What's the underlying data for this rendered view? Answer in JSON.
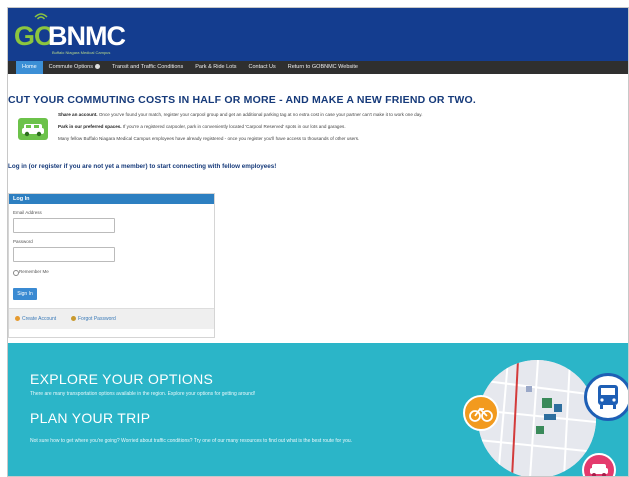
{
  "brand": {
    "logo_go": "GO",
    "logo_name": "BNMC",
    "tagline": "Buffalo Niagara Medical Campus"
  },
  "nav": {
    "items": [
      {
        "label": "Home",
        "active": true
      },
      {
        "label": "Commute Options",
        "has_dropdown": true
      },
      {
        "label": "Transit and Traffic Conditions"
      },
      {
        "label": "Park & Ride Lots"
      },
      {
        "label": "Contact Us"
      },
      {
        "label": "Return to GOBNMC Website"
      }
    ]
  },
  "main": {
    "headline": "CUT YOUR COMMUTING COSTS IN HALF OR MORE - AND MAKE A NEW FRIEND OR TWO.",
    "benefits": [
      {
        "bold": "Share an account.",
        "text": " Once you've found your match, register your carpool group and get an additional parking tag at no extra cost in case your partner can't make it to work one day."
      },
      {
        "bold": "Park in our preferred spaces.",
        "text": " If you're a registered carpooler, park in conveniently located 'Carpool Reserved' spots in our lots and garages."
      },
      {
        "bold": "",
        "text": "Many fellow Buffalo Niagara Medical Campus employees have already registered - once you register you'll have access to thousands of other users."
      }
    ],
    "login_prompt": "Log in (or register if you are not yet a member) to start connecting with fellow employees!"
  },
  "login": {
    "title": "Log In",
    "email_label": "Email Address",
    "email_value": "",
    "password_label": "Password",
    "password_value": "",
    "remember_label": "Remember Me",
    "signin_label": "Sign In",
    "create_account": "Create Account",
    "forgot_password": "Forgot Password"
  },
  "band": {
    "explore_title": "EXPLORE YOUR OPTIONS",
    "explore_text": "There are many transportation options available in the region. Explore your options for getting around!",
    "plan_title": "PLAN YOUR TRIP",
    "plan_text": "Not sure how to get where you're going? Worried about traffic conditions? Try one of our many resources to find out what is the best route for you."
  },
  "colors": {
    "header": "#143d8f",
    "nav": "#2f2f2f",
    "nav_active": "#3c8fd6",
    "accent_green": "#6cc24a",
    "band": "#2bb5c8"
  },
  "icons": [
    "wifi-icon",
    "car-icon",
    "user-icon",
    "key-icon",
    "bike-icon",
    "bus-icon",
    "car-pink-icon",
    "map-graphic"
  ]
}
